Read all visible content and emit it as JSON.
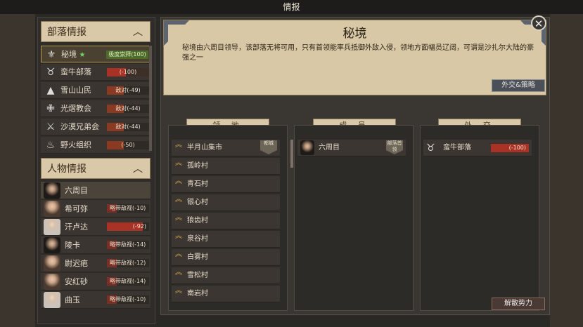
{
  "window_title": "情报",
  "sidebar": {
    "tribe_header": "部落情报",
    "tribes": [
      {
        "name": "秘境",
        "badge": "极度崇拜(100)",
        "badge_style": "green",
        "icon": "shield-icon",
        "starred": true,
        "star": "★"
      },
      {
        "name": "蛮牛部落",
        "badge": "(-100)",
        "badge_style": "redbar",
        "icon": "bull-skull-icon"
      },
      {
        "name": "雪山山民",
        "badge": "敌对(-49)",
        "badge_style": "dark",
        "icon": "mountain-icon"
      },
      {
        "name": "光熠教会",
        "badge": "敌对(-44)",
        "badge_style": "dark",
        "icon": "flame-cross-icon"
      },
      {
        "name": "沙漠兄弟会",
        "badge": "敌对(-44)",
        "badge_style": "dark",
        "icon": "crossed-swords-icon"
      },
      {
        "name": "野火组织",
        "badge": "(-50)",
        "badge_style": "bar-l",
        "icon": "wildfire-icon"
      }
    ],
    "person_header": "人物情报",
    "persons": [
      {
        "name": "六周目",
        "badge": "",
        "portrait": "dark"
      },
      {
        "name": "希可弥",
        "badge": "略带敌视(-10)",
        "portrait": "normal"
      },
      {
        "name": "汗卢达",
        "badge": "(-92)",
        "portrait": "white"
      },
      {
        "name": "陵卡",
        "badge": "略带敌视(-14)",
        "portrait": "dark"
      },
      {
        "name": "尉迟疤",
        "badge": "略带敌视(-12)",
        "portrait": "normal"
      },
      {
        "name": "安红砂",
        "badge": "略带敌视(-14)",
        "portrait": "normal"
      },
      {
        "name": "曲玉",
        "badge": "略带敌视(-10)",
        "portrait": "white"
      }
    ]
  },
  "detail": {
    "title": "秘境",
    "description": "秘境由六周目领导，该部落无将可用，只有首领能率兵抵御外敌入侵，领地方面幅员辽阔，可谓是沙扎尔大陆的豪强之一",
    "diplomacy_button": "外交&策略",
    "disband_button": "解散势力",
    "close_icon": "close-icon",
    "close_glyph": "✕"
  },
  "columns": {
    "territory": {
      "header": "领 地",
      "items": [
        {
          "name": "半月山集市",
          "tag": "都城"
        },
        {
          "name": "孤岭村"
        },
        {
          "name": "青石村"
        },
        {
          "name": "银心村"
        },
        {
          "name": "狼齿村"
        },
        {
          "name": "泉谷村"
        },
        {
          "name": "白雾村"
        },
        {
          "name": "雪松村"
        },
        {
          "name": "南岩村"
        }
      ]
    },
    "members": {
      "header": "成 员",
      "items": [
        {
          "name": "六周目",
          "tag": "部落首领"
        }
      ]
    },
    "diplomacy": {
      "header": "外 交",
      "items": [
        {
          "name": "蛮牛部落",
          "badge": "(-100)"
        }
      ]
    }
  }
}
